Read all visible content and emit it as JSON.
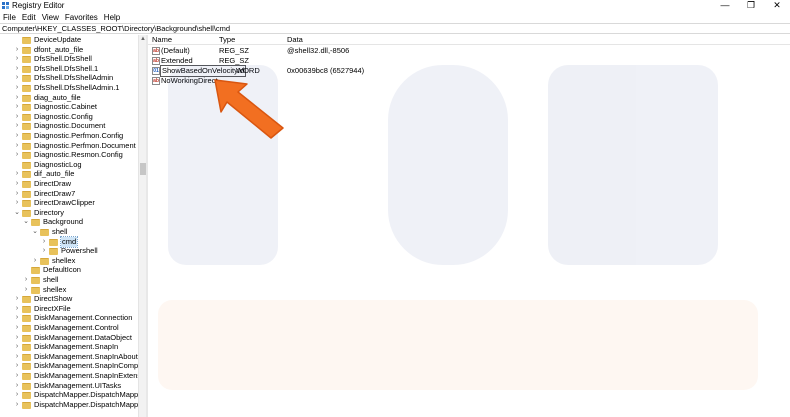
{
  "window": {
    "title": "Registry Editor",
    "controls": {
      "minimize": "—",
      "maximize": "❐",
      "close": "✕"
    }
  },
  "menu": [
    "File",
    "Edit",
    "View",
    "Favorites",
    "Help"
  ],
  "address": "Computer\\HKEY_CLASSES_ROOT\\Directory\\Background\\shell\\cmd",
  "tree": [
    {
      "label": "DeviceUpdate",
      "depth": 0,
      "expander": ""
    },
    {
      "label": "dfont_auto_file",
      "depth": 0,
      "expander": "›"
    },
    {
      "label": "DfsShell.DfsShell",
      "depth": 0,
      "expander": "›"
    },
    {
      "label": "DfsShell.DfsShell.1",
      "depth": 0,
      "expander": "›"
    },
    {
      "label": "DfsShell.DfsShellAdmin",
      "depth": 0,
      "expander": "›"
    },
    {
      "label": "DfsShell.DfsShellAdmin.1",
      "depth": 0,
      "expander": "›"
    },
    {
      "label": "diag_auto_file",
      "depth": 0,
      "expander": "›"
    },
    {
      "label": "Diagnostic.Cabinet",
      "depth": 0,
      "expander": "›"
    },
    {
      "label": "Diagnostic.Config",
      "depth": 0,
      "expander": "›"
    },
    {
      "label": "Diagnostic.Document",
      "depth": 0,
      "expander": "›"
    },
    {
      "label": "Diagnostic.Perfmon.Config",
      "depth": 0,
      "expander": "›"
    },
    {
      "label": "Diagnostic.Perfmon.Document",
      "depth": 0,
      "expander": "›"
    },
    {
      "label": "Diagnostic.Resmon.Config",
      "depth": 0,
      "expander": "›"
    },
    {
      "label": "DiagnosticLog",
      "depth": 0,
      "expander": ""
    },
    {
      "label": "dif_auto_file",
      "depth": 0,
      "expander": "›"
    },
    {
      "label": "DirectDraw",
      "depth": 0,
      "expander": "›"
    },
    {
      "label": "DirectDraw7",
      "depth": 0,
      "expander": "›"
    },
    {
      "label": "DirectDrawClipper",
      "depth": 0,
      "expander": "›"
    },
    {
      "label": "Directory",
      "depth": 0,
      "expander": "⌄"
    },
    {
      "label": "Background",
      "depth": 1,
      "expander": "⌄"
    },
    {
      "label": "shell",
      "depth": 2,
      "expander": "⌄"
    },
    {
      "label": "cmd",
      "depth": 3,
      "expander": "›",
      "selected": true
    },
    {
      "label": "Powershell",
      "depth": 3,
      "expander": "›"
    },
    {
      "label": "shellex",
      "depth": 2,
      "expander": "›"
    },
    {
      "label": "DefaultIcon",
      "depth": 1,
      "expander": ""
    },
    {
      "label": "shell",
      "depth": 1,
      "expander": "›"
    },
    {
      "label": "shellex",
      "depth": 1,
      "expander": "›"
    },
    {
      "label": "DirectShow",
      "depth": 0,
      "expander": "›"
    },
    {
      "label": "DirectXFile",
      "depth": 0,
      "expander": "›"
    },
    {
      "label": "DiskManagement.Connection",
      "depth": 0,
      "expander": "›"
    },
    {
      "label": "DiskManagement.Control",
      "depth": 0,
      "expander": "›"
    },
    {
      "label": "DiskManagement.DataObject",
      "depth": 0,
      "expander": "›"
    },
    {
      "label": "DiskManagement.SnapIn",
      "depth": 0,
      "expander": "›"
    },
    {
      "label": "DiskManagement.SnapInAbout",
      "depth": 0,
      "expander": "›"
    },
    {
      "label": "DiskManagement.SnapInCompor",
      "depth": 0,
      "expander": "›"
    },
    {
      "label": "DiskManagement.SnapInExtensic",
      "depth": 0,
      "expander": "›"
    },
    {
      "label": "DiskManagement.UITasks",
      "depth": 0,
      "expander": "›"
    },
    {
      "label": "DispatchMapper.DispatchMappe",
      "depth": 0,
      "expander": "›"
    },
    {
      "label": "DispatchMapper.DispatchMappe",
      "depth": 0,
      "expander": "›"
    }
  ],
  "list": {
    "columns": [
      "Name",
      "Type",
      "Data"
    ],
    "rows": [
      {
        "name": "(Default)",
        "type": "REG_SZ",
        "data": "@shell32.dll,-8506",
        "kind": "ab"
      },
      {
        "name": "Extended",
        "type": "REG_SZ",
        "data": "",
        "kind": "ab"
      },
      {
        "name": "ShowBasedOnVelocityId",
        "type": "WORD",
        "data": "0x00639bc8 (6527944)",
        "kind": "bin",
        "editing": true
      },
      {
        "name": "NoWorkingDirect...",
        "type": "",
        "data": "",
        "kind": "ab"
      }
    ]
  },
  "colors": {
    "arrow": "#f26f21",
    "selection": "#cfe5f7",
    "folder": "#e8c25b"
  }
}
